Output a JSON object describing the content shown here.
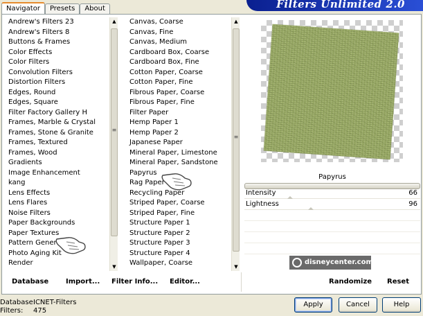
{
  "brand": {
    "text": "Filters Unlimited 2.0"
  },
  "tabs": [
    {
      "label": "Navigator",
      "active": true
    },
    {
      "label": "Presets",
      "active": false
    },
    {
      "label": "About",
      "active": false
    }
  ],
  "categories": {
    "items": [
      "Andrew's Filters 23",
      "Andrew's Filters 8",
      "Buttons & Frames",
      "Color Effects",
      "Color Filters",
      "Convolution Filters",
      "Distortion Filters",
      "Edges, Round",
      "Edges, Square",
      "Filter Factory Gallery H",
      "Frames, Marble & Crystal",
      "Frames, Stone & Granite",
      "Frames, Textured",
      "Frames, Wood",
      "Gradients",
      "Image Enhancement",
      "kang",
      "Lens Effects",
      "Lens Flares",
      "Noise Filters",
      "Paper Backgrounds",
      "Paper Textures",
      "Pattern Generators",
      "Photo Aging Kit",
      "Render"
    ],
    "selected": "Paper Textures"
  },
  "filters": {
    "items": [
      "Canvas, Coarse",
      "Canvas, Fine",
      "Canvas, Medium",
      "Cardboard Box, Coarse",
      "Cardboard Box, Fine",
      "Cotton Paper, Coarse",
      "Cotton Paper, Fine",
      "Fibrous Paper, Coarse",
      "Fibrous Paper, Fine",
      "Filter Paper",
      "Hemp Paper 1",
      "Hemp Paper 2",
      "Japanese Paper",
      "Mineral Paper, Limestone",
      "Mineral Paper, Sandstone",
      "Papyrus",
      "Rag Paper",
      "Recycling Paper",
      "Striped Paper, Coarse",
      "Striped Paper, Fine",
      "Structure Paper 1",
      "Structure Paper 2",
      "Structure Paper 3",
      "Structure Paper 4",
      "Wallpaper, Coarse"
    ],
    "selected": "Papyrus"
  },
  "preview": {
    "filter_name": "Papyrus"
  },
  "sliders": [
    {
      "label": "Intensity",
      "value": "66"
    },
    {
      "label": "Lightness",
      "value": "96"
    }
  ],
  "watermark": "disneycenter.com",
  "toolbar": {
    "database": "Database",
    "import": "Import...",
    "filter_info": "Filter Info...",
    "editor": "Editor...",
    "randomize": "Randomize",
    "reset": "Reset"
  },
  "status": {
    "database_label": "Database:",
    "database_value": "ICNET-Filters",
    "filters_label": "Filters:",
    "filters_value": "475"
  },
  "buttons": {
    "apply": "Apply",
    "cancel": "Cancel",
    "help": "Help"
  },
  "colors": {
    "banner": "#0a1f8f",
    "paper": "#9aab67",
    "tab_accent": "#e68b2c"
  }
}
